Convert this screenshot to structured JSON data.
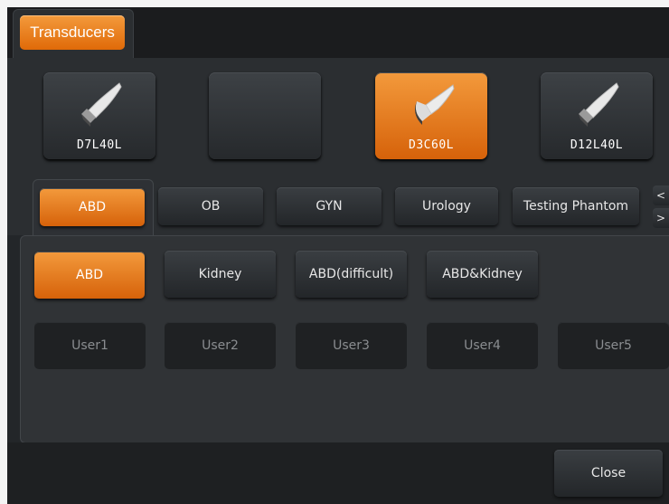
{
  "tab": {
    "label": "Transducers"
  },
  "probes": [
    {
      "label": "D7L40L",
      "selected": false,
      "icon": "linear-probe-icon"
    },
    {
      "label": "",
      "selected": false,
      "icon": ""
    },
    {
      "label": "D3C60L",
      "selected": true,
      "icon": "convex-probe-icon"
    },
    {
      "label": "D12L40L",
      "selected": false,
      "icon": "linear-probe-icon"
    }
  ],
  "exam_types": [
    {
      "label": "ABD",
      "selected": true
    },
    {
      "label": "OB",
      "selected": false
    },
    {
      "label": "GYN",
      "selected": false
    },
    {
      "label": "Urology",
      "selected": false
    },
    {
      "label": "Testing Phantom",
      "selected": false
    }
  ],
  "nav": {
    "prev": "<",
    "next": ">"
  },
  "presets": [
    {
      "label": "ABD",
      "selected": true
    },
    {
      "label": "Kidney",
      "selected": false
    },
    {
      "label": "ABD(difficult)",
      "selected": false
    },
    {
      "label": "ABD&Kidney",
      "selected": false
    }
  ],
  "user_presets": [
    "User1",
    "User2",
    "User3",
    "User4",
    "User5"
  ],
  "close_label": "Close",
  "colors": {
    "accent": "#e87a16",
    "background": "#232629"
  }
}
